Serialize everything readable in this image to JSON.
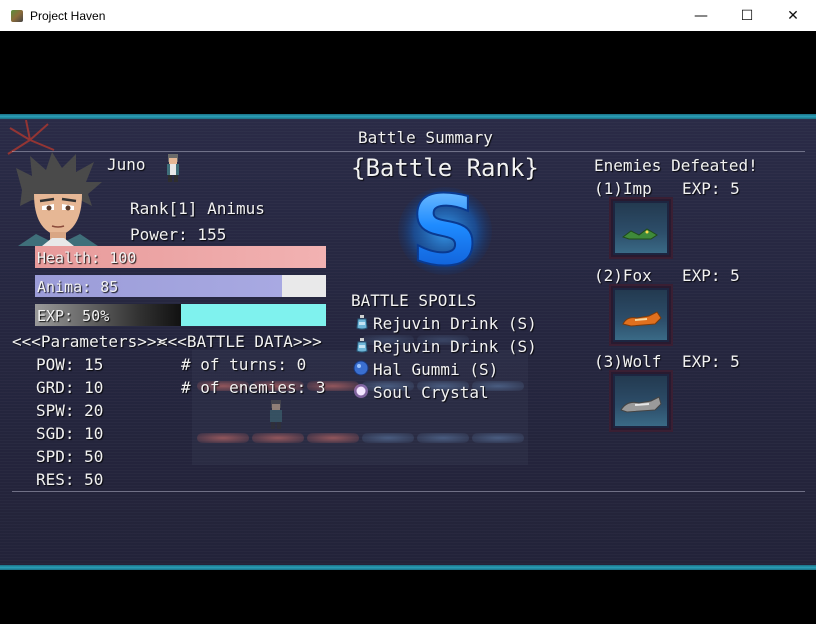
{
  "window": {
    "title": "Project Haven",
    "minimize": "—",
    "maximize": "☐",
    "close": "✕"
  },
  "summary": {
    "title": "Battle Summary",
    "hero": {
      "name": "Juno",
      "rank": "Rank[1] Animus",
      "power": "Power: 155",
      "health_label": "Health: 100",
      "health_fraction": 1.0,
      "anima_label": "Anima: 85",
      "anima_fraction": 0.85,
      "exp_label": "EXP: 50%",
      "exp_fraction": 0.5
    },
    "parameters_header": "<<<Parameters>>>",
    "parameters": [
      {
        "label": "POW: 15"
      },
      {
        "label": "GRD: 10"
      },
      {
        "label": "SPW: 20"
      },
      {
        "label": "SGD: 10"
      },
      {
        "label": "SPD: 50"
      },
      {
        "label": "RES: 50"
      }
    ],
    "battle_data_header": "<<<BATTLE DATA>>>",
    "battle_data": [
      {
        "label": "# of turns: 0"
      },
      {
        "label": "# of enemies: 3"
      }
    ],
    "battle_rank_label": "{Battle Rank}",
    "battle_rank": "S",
    "spoils_header": "BATTLE SPOILS",
    "spoils": [
      {
        "name": "Rejuvin Drink (S)",
        "icon": "potion-icon",
        "color": "#6fb6d8"
      },
      {
        "name": "Rejuvin Drink (S)",
        "icon": "potion-icon",
        "color": "#6fb6d8"
      },
      {
        "name": "Hal Gummi (S)",
        "icon": "gummi-icon",
        "color": "#3a6fd0"
      },
      {
        "name": "Soul Crystal",
        "icon": "crystal-icon",
        "color": "#e2c8f2"
      }
    ],
    "enemies_header": "Enemies Defeated!",
    "enemies": [
      {
        "name": "(1)Imp",
        "exp": "EXP: 5",
        "icon": "imp-icon",
        "color": "#3f8a3a"
      },
      {
        "name": "(2)Fox",
        "exp": "EXP: 5",
        "icon": "fox-icon",
        "color": "#e0701e"
      },
      {
        "name": "(3)Wolf",
        "exp": "EXP: 5",
        "icon": "wolf-icon",
        "color": "#9a9a9a"
      }
    ],
    "colors": {
      "health": "#e79a9a",
      "anima": "#a8a9e2",
      "exp": "#7ff2ee",
      "frame_accent": "#2aa0b8",
      "rank_blue": "#1e8bff"
    }
  }
}
